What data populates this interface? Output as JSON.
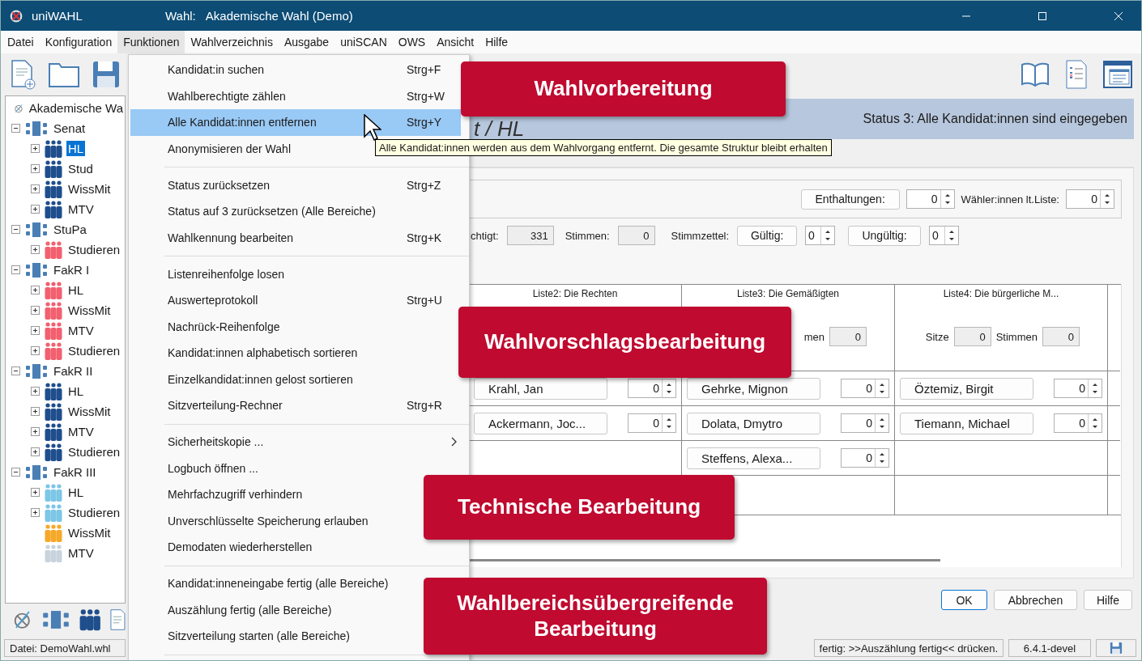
{
  "window": {
    "app_name": "uniWAHL",
    "title_label": "Wahl:",
    "title": "Akademische Wahl (Demo)"
  },
  "menu_bar": [
    {
      "label": "Datei",
      "selected": false
    },
    {
      "label": "Konfiguration",
      "selected": false
    },
    {
      "label": "Funktionen",
      "selected": true
    },
    {
      "label": "Wahlverzeichnis",
      "selected": false
    },
    {
      "label": "Ausgabe",
      "selected": false
    },
    {
      "label": "uniSCAN",
      "selected": false
    },
    {
      "label": "OWS",
      "selected": false
    },
    {
      "label": "Ansicht",
      "selected": false
    },
    {
      "label": "Hilfe",
      "selected": false
    }
  ],
  "tree": [
    {
      "label": "Akademische Wa",
      "kind": "root",
      "selected": false,
      "children": [
        {
          "label": "Senat",
          "kind": "body",
          "selected": false,
          "expanded": true,
          "children": [
            {
              "label": "HL",
              "kind": "group",
              "color": "#1f4e8c",
              "selected": true,
              "expanded": false
            },
            {
              "label": "Stud",
              "kind": "group",
              "color": "#1f4e8c",
              "selected": false,
              "expanded": false
            },
            {
              "label": "WissMit",
              "kind": "group",
              "color": "#1f4e8c",
              "selected": false,
              "expanded": false
            },
            {
              "label": "MTV",
              "kind": "group",
              "color": "#1f4e8c",
              "selected": false,
              "expanded": false
            }
          ]
        },
        {
          "label": "StuPa",
          "kind": "body",
          "selected": false,
          "expanded": true,
          "children": [
            {
              "label": "Studieren",
              "kind": "group",
              "color": "#f2606f",
              "selected": false,
              "expanded": false
            }
          ]
        },
        {
          "label": "FakR I",
          "kind": "body",
          "selected": false,
          "expanded": true,
          "children": [
            {
              "label": "HL",
              "kind": "group",
              "color": "#f2606f",
              "selected": false,
              "expanded": false
            },
            {
              "label": "WissMit",
              "kind": "group",
              "color": "#f2606f",
              "selected": false,
              "expanded": false
            },
            {
              "label": "MTV",
              "kind": "group",
              "color": "#f2606f",
              "selected": false,
              "expanded": false
            },
            {
              "label": "Studieren",
              "kind": "group",
              "color": "#f2606f",
              "selected": false,
              "expanded": false
            }
          ]
        },
        {
          "label": "FakR II",
          "kind": "body",
          "selected": false,
          "expanded": true,
          "children": [
            {
              "label": "HL",
              "kind": "group",
              "color": "#1f4e8c",
              "selected": false,
              "expanded": false
            },
            {
              "label": "WissMit",
              "kind": "group",
              "color": "#1f4e8c",
              "selected": false,
              "expanded": false
            },
            {
              "label": "MTV",
              "kind": "group",
              "color": "#1f4e8c",
              "selected": false,
              "expanded": false
            },
            {
              "label": "Studieren",
              "kind": "group",
              "color": "#1f4e8c",
              "selected": false,
              "expanded": false
            }
          ]
        },
        {
          "label": "FakR III",
          "kind": "body",
          "selected": false,
          "expanded": true,
          "children": [
            {
              "label": "HL",
              "kind": "group",
              "color": "#7cc6e6",
              "selected": false,
              "expanded": false
            },
            {
              "label": "Studieren",
              "kind": "group",
              "color": "#7cc6e6",
              "selected": false,
              "expanded": false
            },
            {
              "label": "WissMit",
              "kind": "group",
              "color": "#f6a829",
              "selected": false
            },
            {
              "label": "MTV",
              "kind": "group",
              "color": "#c9d3dd",
              "selected": false
            }
          ]
        }
      ]
    }
  ],
  "menu": [
    {
      "kind": "item",
      "label": "Kandidat:in suchen",
      "shortcut": "Strg+F",
      "selected": false
    },
    {
      "kind": "item",
      "label": "Wahlberechtigte zählen",
      "shortcut": "Strg+W",
      "selected": false
    },
    {
      "kind": "item",
      "label": "Alle Kandidat:innen entfernen",
      "shortcut": "Strg+Y",
      "selected": true
    },
    {
      "kind": "item",
      "label": "Anonymisieren der Wahl",
      "selected": false
    },
    {
      "kind": "separator"
    },
    {
      "kind": "item",
      "label": "Status zurücksetzen",
      "shortcut": "Strg+Z",
      "selected": false
    },
    {
      "kind": "item",
      "label": "Status auf 3 zurücksetzen (Alle Bereiche)",
      "selected": false
    },
    {
      "kind": "item",
      "label": "Wahlkennung bearbeiten",
      "shortcut": "Strg+K",
      "selected": false
    },
    {
      "kind": "separator"
    },
    {
      "kind": "item",
      "label": "Listenreihenfolge losen",
      "selected": false
    },
    {
      "kind": "item",
      "label": "Auswerteprotokoll",
      "shortcut": "Strg+U",
      "selected": false
    },
    {
      "kind": "item",
      "label": "Nachrück-Reihenfolge",
      "selected": false
    },
    {
      "kind": "item",
      "label": "Kandidat:innen alphabetisch sortieren",
      "selected": false
    },
    {
      "kind": "item",
      "label": "Einzelkandidat:innen gelost sortieren",
      "selected": false
    },
    {
      "kind": "item",
      "label": "Sitzverteilung-Rechner",
      "shortcut": "Strg+R",
      "selected": false
    },
    {
      "kind": "separator"
    },
    {
      "kind": "item",
      "label": "Sicherheitskopie ...",
      "submenu": true,
      "selected": false
    },
    {
      "kind": "item",
      "label": "Logbuch öffnen ...",
      "selected": false
    },
    {
      "kind": "item",
      "label": "Mehrfachzugriff verhindern",
      "selected": false
    },
    {
      "kind": "item",
      "label": "Unverschlüsselte Speicherung erlauben",
      "selected": false
    },
    {
      "kind": "item",
      "label": "Demodaten wiederherstellen",
      "selected": false
    },
    {
      "kind": "separator"
    },
    {
      "kind": "item",
      "label": "Kandidat:inneneingabe fertig (alle Bereiche)",
      "selected": false
    },
    {
      "kind": "item",
      "label": "Auszählung fertig (alle Bereiche)",
      "selected": false
    },
    {
      "kind": "item",
      "label": "Sitzverteilung starten (alle Bereiche)",
      "selected": false
    },
    {
      "kind": "separator"
    }
  ],
  "tooltip": "Alle Kandidat:innen werden aus dem Wahlvorgang entfernt. Die gesamte Struktur bleibt erhalten",
  "header": {
    "title": "t / HL",
    "status": "Status 3: Alle Kandidat:innen sind eingegeben"
  },
  "totals": {
    "abstentions_button": "Enthaltungen:",
    "abstentions": "0",
    "voters_label": "Wähler:innen lt.Liste:",
    "voters": "0",
    "eligible_label": "chtigt:",
    "eligible": "331",
    "votes_label": "Stimmen:",
    "votes": "0",
    "ballots_label": "Stimmzettel:",
    "valid_button": "Gültig:",
    "valid": "0",
    "invalid_button": "Ungültig:",
    "invalid": "0"
  },
  "lists": [
    {
      "name": "Liste2: Die Rechten",
      "candidates": [
        {
          "name": "Krahl, Jan",
          "votes": "0"
        },
        {
          "name": "Ackermann, Joc...",
          "votes": "0"
        }
      ]
    },
    {
      "name": "Liste3: Die Gemäßigten",
      "tally": [
        {
          "kind": "label",
          "text": "men"
        },
        {
          "kind": "field",
          "text": "0"
        }
      ],
      "candidates": [
        {
          "name": "Gehrke, Mignon",
          "votes": "0"
        },
        {
          "name": "Dolata, Dmytro",
          "votes": "0"
        },
        {
          "name": "Steffens, Alexa...",
          "votes": "0"
        }
      ]
    },
    {
      "name": "Liste4: Die bürgerliche M...",
      "tally": [
        {
          "kind": "label",
          "text": "Sitze"
        },
        {
          "kind": "field",
          "text": "0"
        },
        {
          "kind": "label",
          "text": "Stimmen"
        },
        {
          "kind": "field",
          "text": "0"
        }
      ],
      "candidates": [
        {
          "name": "Öztemiz, Birgit",
          "votes": "0"
        },
        {
          "name": "Tiemann, Michael",
          "votes": "0"
        }
      ]
    }
  ],
  "dialog_buttons": [
    {
      "label": "OK",
      "default": true
    },
    {
      "label": "Abbrechen",
      "default": false
    },
    {
      "label": "Hilfe",
      "default": false
    }
  ],
  "status_bar": {
    "file": "Datei: DemoWahl.whl",
    "hint": "fertig: >>Auszählung fertig<< drücken.",
    "version": "6.4.1-devel"
  },
  "callouts": [
    {
      "label": "Wahlvorbereitung",
      "kind": "prep"
    },
    {
      "label": "Wahlvorschlagsbearbeitung",
      "kind": "proposal"
    },
    {
      "label": "Technische Bearbeitung",
      "kind": "tech"
    },
    {
      "label": "Wahlbereichsübergreifende Bearbeitung",
      "kind": "global"
    }
  ]
}
